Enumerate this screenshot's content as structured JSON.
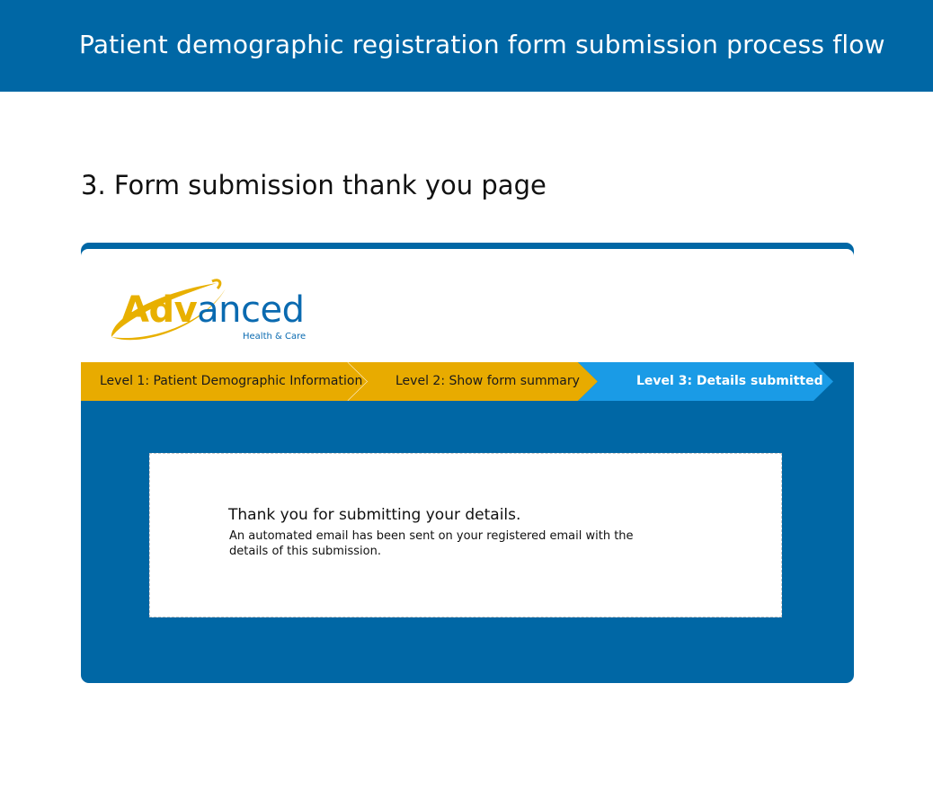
{
  "header": {
    "title": "Patient demographic registration form submission process flow"
  },
  "section": {
    "heading": "3. Form submission thank you page"
  },
  "logo": {
    "word_part1": "Adv",
    "word_part2": "anced",
    "tagline": "Health & Care",
    "colors": {
      "gold": "#e8b000",
      "blue": "#0a6ab0"
    }
  },
  "steps": [
    {
      "label": "Level 1: Patient Demographic Information",
      "state": "completed",
      "color": "#e8ab00"
    },
    {
      "label": "Level 2: Show form summary",
      "state": "completed",
      "color": "#e8ab00"
    },
    {
      "label": "Level 3: Details submitted",
      "state": "current",
      "color": "#1a9be6"
    }
  ],
  "message": {
    "title": "Thank you for submitting your details.",
    "body": "An automated email has been sent on your registered email with the details of this submission."
  },
  "colors": {
    "primary": "#0067a5",
    "step_completed": "#e8ab00",
    "step_current": "#1a9be6",
    "background": "#ffffff"
  }
}
